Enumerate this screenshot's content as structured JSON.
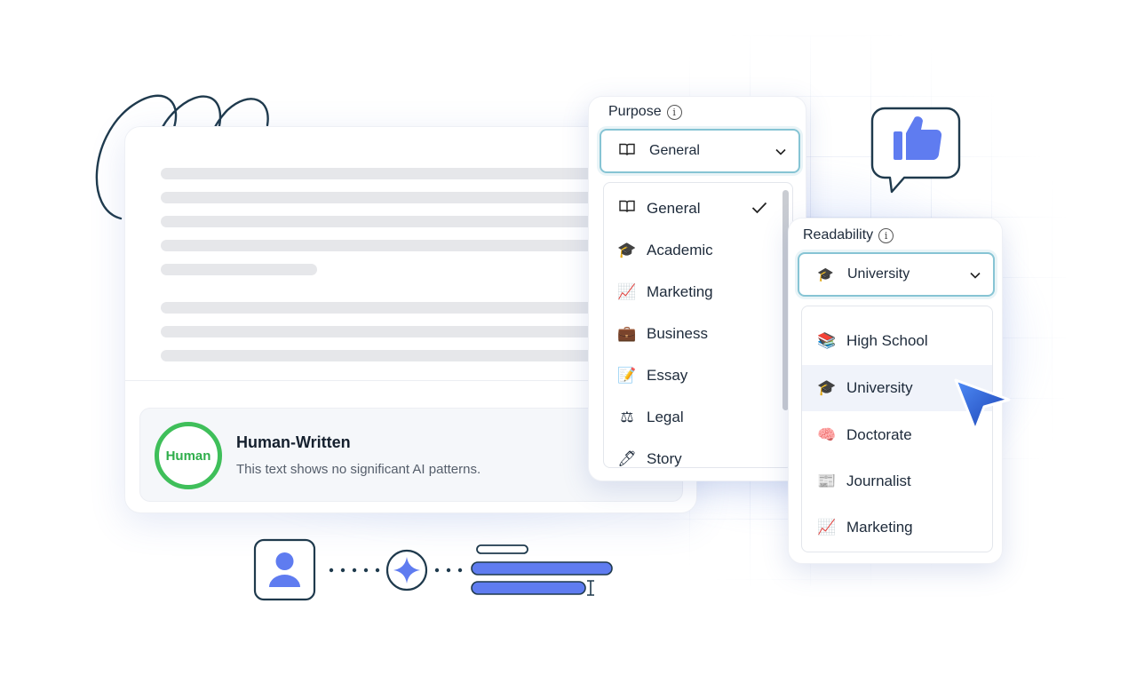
{
  "verdict": {
    "badge": "Human",
    "title": "Human-Written",
    "description": "This text shows no significant AI patterns."
  },
  "purpose": {
    "label": "Purpose",
    "selected": "General",
    "options": [
      {
        "label": "General",
        "icon": "book-icon",
        "checked": true
      },
      {
        "label": "Academic",
        "icon": "graduation-cap-icon"
      },
      {
        "label": "Marketing",
        "icon": "chart-icon"
      },
      {
        "label": "Business",
        "icon": "briefcase-icon"
      },
      {
        "label": "Essay",
        "icon": "memo-icon"
      },
      {
        "label": "Legal",
        "icon": "scales-icon"
      },
      {
        "label": "Story",
        "icon": "pen-icon"
      }
    ]
  },
  "readability": {
    "label": "Readability",
    "selected": "University",
    "options": [
      {
        "label": "High School",
        "icon": "books-icon"
      },
      {
        "label": "University",
        "icon": "graduation-cap-icon",
        "highlighted": true
      },
      {
        "label": "Doctorate",
        "icon": "brain-icon"
      },
      {
        "label": "Journalist",
        "icon": "newspaper-icon"
      },
      {
        "label": "Marketing",
        "icon": "chart-icon"
      }
    ]
  },
  "colors": {
    "accent": "#5a78f0",
    "select_border": "#86c4d4",
    "human_green": "#3fbf5a",
    "ink": "#1f3a4d"
  }
}
